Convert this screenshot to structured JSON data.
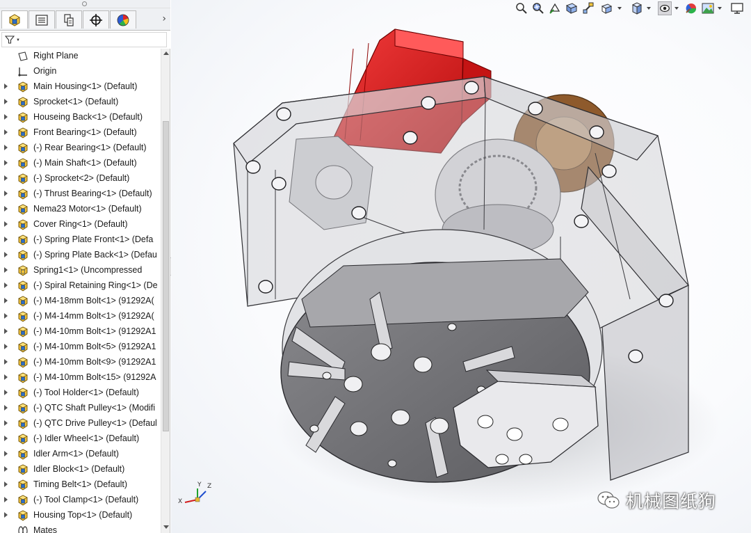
{
  "panel": {
    "tabs": [
      {
        "name": "feature-manager-tab",
        "icon": "assembly-icon",
        "active": true
      },
      {
        "name": "property-manager-tab",
        "icon": "property-list-icon"
      },
      {
        "name": "configuration-manager-tab",
        "icon": "configuration-icon"
      },
      {
        "name": "dim-xpert-tab",
        "icon": "crosshair-icon"
      },
      {
        "name": "display-manager-tab",
        "icon": "appearance-pie-icon"
      }
    ],
    "filter_icon": "filter-icon"
  },
  "tree": {
    "items": [
      {
        "label": "Right Plane",
        "type": "plane",
        "expandable": false
      },
      {
        "label": "Origin",
        "type": "origin",
        "expandable": false
      },
      {
        "label": "Main Housing<1> (Default)",
        "type": "part",
        "expandable": true
      },
      {
        "label": "Sprocket<1> (Default)",
        "type": "part",
        "expandable": true
      },
      {
        "label": "Houseing Back<1> (Default)",
        "type": "part",
        "expandable": true
      },
      {
        "label": "Front Bearing<1> (Default)",
        "type": "part",
        "expandable": true
      },
      {
        "label": "(-) Rear Bearing<1> (Default)",
        "type": "part",
        "expandable": true
      },
      {
        "label": "(-) Main Shaft<1> (Default)",
        "type": "part",
        "expandable": true
      },
      {
        "label": "(-) Sprocket<2> (Default)",
        "type": "part",
        "expandable": true
      },
      {
        "label": "(-) Thrust Bearing<1> (Default)",
        "type": "part",
        "expandable": true
      },
      {
        "label": "Nema23 Motor<1> (Default)",
        "type": "part",
        "expandable": true
      },
      {
        "label": "Cover Ring<1> (Default)",
        "type": "part",
        "expandable": true
      },
      {
        "label": "(-) Spring Plate Front<1> (Defa",
        "type": "part",
        "expandable": true
      },
      {
        "label": "(-) Spring Plate Back<1> (Defau",
        "type": "part",
        "expandable": true
      },
      {
        "label": "Spring1<1> (Uncompressed",
        "type": "part-special",
        "expandable": true
      },
      {
        "label": "(-) Spiral Retaining Ring<1> (De",
        "type": "part",
        "expandable": true
      },
      {
        "label": "(-) M4-18mm Bolt<1> (91292A(",
        "type": "part",
        "expandable": true
      },
      {
        "label": "(-) M4-14mm Bolt<1> (91292A(",
        "type": "part",
        "expandable": true
      },
      {
        "label": "(-) M4-10mm Bolt<1> (91292A1",
        "type": "part",
        "expandable": true
      },
      {
        "label": "(-) M4-10mm Bolt<5> (91292A1",
        "type": "part",
        "expandable": true
      },
      {
        "label": "(-) M4-10mm Bolt<9> (91292A1",
        "type": "part",
        "expandable": true
      },
      {
        "label": "(-) M4-10mm Bolt<15> (91292A",
        "type": "part",
        "expandable": true
      },
      {
        "label": "(-) Tool Holder<1> (Default)",
        "type": "part",
        "expandable": true
      },
      {
        "label": "(-) QTC Shaft Pulley<1> (Modifi",
        "type": "part",
        "expandable": true
      },
      {
        "label": "(-) QTC Drive Pulley<1> (Defaul",
        "type": "part",
        "expandable": true
      },
      {
        "label": "(-) Idler Wheel<1> (Default)",
        "type": "part",
        "expandable": true
      },
      {
        "label": "Idler Arm<1> (Default)",
        "type": "part",
        "expandable": true
      },
      {
        "label": "Idler Block<1> (Default)",
        "type": "part",
        "expandable": true
      },
      {
        "label": "Timing Belt<1> (Default)",
        "type": "part",
        "expandable": true
      },
      {
        "label": "(-) Tool Clamp<1> (Default)",
        "type": "part",
        "expandable": true
      },
      {
        "label": "Housing Top<1> (Default)",
        "type": "part",
        "expandable": true
      },
      {
        "label": "Mates",
        "type": "mates",
        "expandable": false
      }
    ]
  },
  "viewport_toolbar": {
    "icons": [
      "zoom-to-fit-icon",
      "zoom-to-area-icon",
      "previous-view-icon",
      "section-view-icon",
      "dynamic-annotation-icon",
      "view-orientation-icon",
      "display-style-icon",
      "hide-show-items-icon",
      "edit-appearance-icon",
      "apply-scene-icon",
      "view-settings-icon"
    ]
  },
  "triad": {
    "x": "X",
    "y": "Y",
    "z": "Z"
  },
  "watermark": {
    "text": "机械图纸狗",
    "icon": "wechat-icon"
  },
  "colors": {
    "motor_red": "#e01a1a",
    "housing_gray": "#c8c8cc",
    "tool_holder": "#6e6e72",
    "panel_bg": "#eef0f3"
  }
}
